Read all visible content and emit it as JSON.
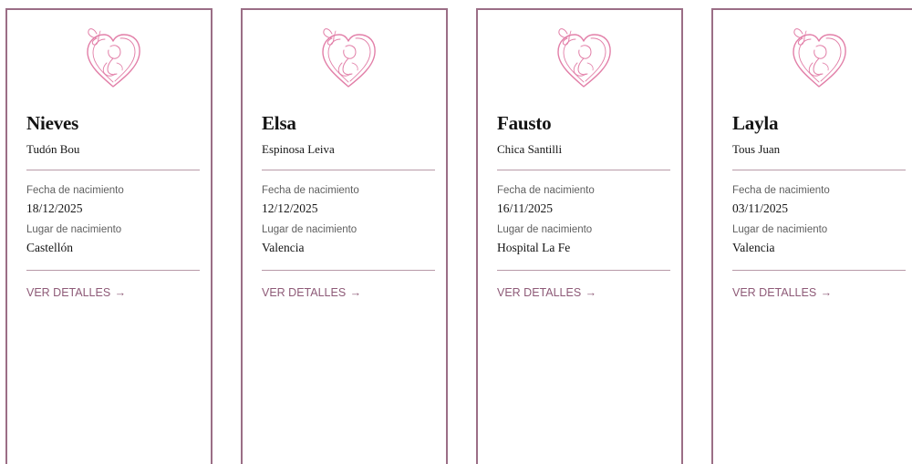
{
  "accent_color": "#8e5a77",
  "border_color": "#9b6e86",
  "logo_icon": "heart-mother-baby-butterfly-icon",
  "labels": {
    "birth_date": "Fecha de nacimiento",
    "birth_place": "Lugar de nacimiento",
    "details_link": "VER DETALLES",
    "arrow": "→"
  },
  "cards": [
    {
      "first_name": "Nieves",
      "last_name": "Tudón Bou",
      "birth_date": "18/12/2025",
      "birth_place": "Castellón"
    },
    {
      "first_name": "Elsa",
      "last_name": "Espinosa Leiva",
      "birth_date": "12/12/2025",
      "birth_place": "Valencia"
    },
    {
      "first_name": "Fausto",
      "last_name": "Chica Santilli",
      "birth_date": "16/11/2025",
      "birth_place": "Hospital La Fe"
    },
    {
      "first_name": "Layla",
      "last_name": "Tous Juan",
      "birth_date": "03/11/2025",
      "birth_place": "Valencia"
    }
  ]
}
